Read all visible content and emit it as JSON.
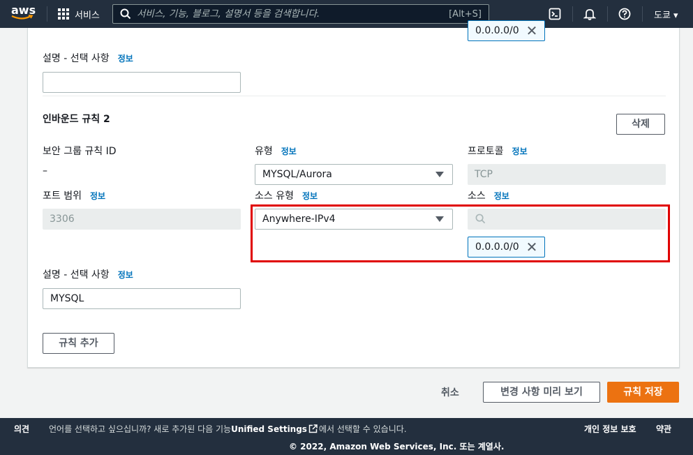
{
  "topnav": {
    "logo_text": "aws",
    "services_label": "서비스",
    "search_placeholder": "서비스, 기능, 블로그, 설명서 등을 검색합니다.",
    "search_shortcut": "[Alt+S]",
    "region_label": "도쿄 ▾"
  },
  "prev_rule": {
    "source_token": "0.0.0.0/0",
    "description_label": "설명 - 선택 사항",
    "info": "정보",
    "description_value": ""
  },
  "rule2": {
    "title": "인바운드 규칙 2",
    "delete_button": "삭제",
    "sg_rule_id_label": "보안 그룹 규칙 ID",
    "sg_rule_id_value": "–",
    "type_label": "유형",
    "type_value": "MYSQL/Aurora",
    "protocol_label": "프로토콜",
    "protocol_value": "TCP",
    "port_label": "포트 범위",
    "port_value": "3306",
    "source_type_label": "소스 유형",
    "source_type_value": "Anywhere-IPv4",
    "source_label": "소스",
    "source_search_value": "",
    "source_token": "0.0.0.0/0",
    "description_label": "설명 - 선택 사항",
    "description_value": "MYSQL",
    "info": "정보"
  },
  "add_rule_button": "규칙 추가",
  "actions": {
    "cancel": "취소",
    "preview": "변경 사항 미리 보기",
    "save": "규칙 저장"
  },
  "footer": {
    "feedback": "의견",
    "language_notice_pre": "언어를 선택하고 싶으십니까? 새로 추가된 다음 기능",
    "unified_settings": "Unified Settings",
    "language_notice_post": "에서 선택할 수 있습니다.",
    "privacy": "개인 정보 보호",
    "terms": "약관",
    "copyright": "© 2022, Amazon Web Services, Inc. 또는 계열사."
  },
  "colors": {
    "nav_bg": "#232f3e",
    "link": "#0073bb",
    "primary": "#ec7211",
    "highlight": "#e00000"
  }
}
